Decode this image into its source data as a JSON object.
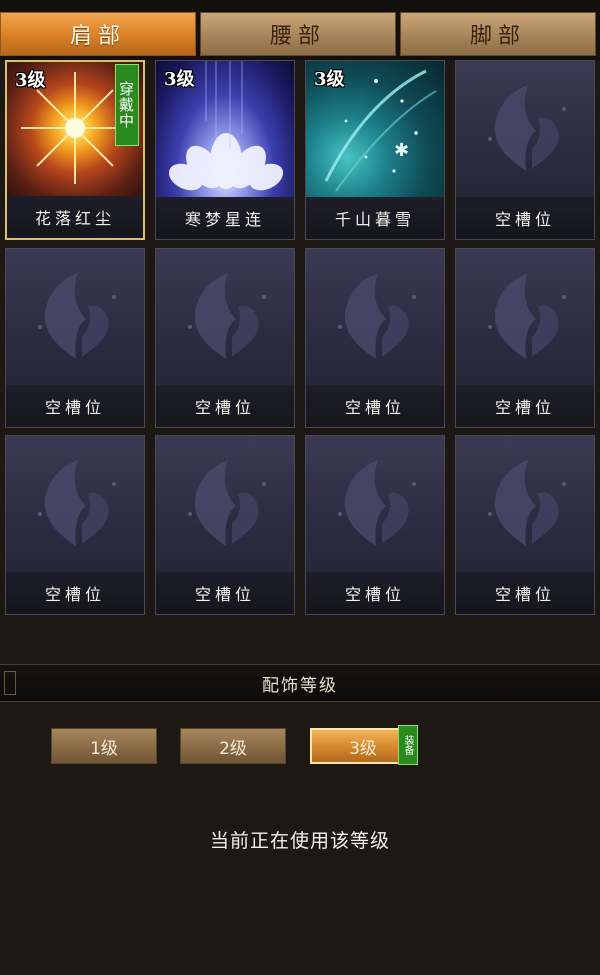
{
  "tabs": [
    {
      "label": "肩部",
      "active": true
    },
    {
      "label": "腰部",
      "active": false
    },
    {
      "label": "脚部",
      "active": false
    }
  ],
  "slots": [
    {
      "name": "花落红尘",
      "level": "3级",
      "worn": "穿戴中",
      "art": "red-starburst"
    },
    {
      "name": "寒梦星连",
      "level": "3级",
      "art": "lotus"
    },
    {
      "name": "千山暮雪",
      "level": "3级",
      "art": "snow"
    },
    {
      "name": "空槽位",
      "empty": true
    },
    {
      "name": "空槽位",
      "empty": true
    },
    {
      "name": "空槽位",
      "empty": true
    },
    {
      "name": "空槽位",
      "empty": true
    },
    {
      "name": "空槽位",
      "empty": true
    },
    {
      "name": "空槽位",
      "empty": true
    },
    {
      "name": "空槽位",
      "empty": true
    },
    {
      "name": "空槽位",
      "empty": true
    },
    {
      "name": "空槽位",
      "empty": true
    }
  ],
  "section": {
    "title": "配饰等级"
  },
  "levels": [
    {
      "label": "1级",
      "active": false
    },
    {
      "label": "2级",
      "active": false
    },
    {
      "label": "3级",
      "active": true,
      "badge": "装备"
    }
  ],
  "status_text": "当前正在使用该等级",
  "colors": {
    "accent": "#dc8327",
    "worn_green": "#2a8a1e",
    "selected_border": "#d8c26e"
  }
}
